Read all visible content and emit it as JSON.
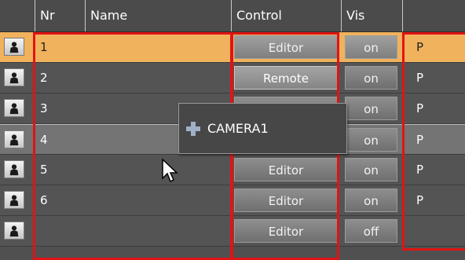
{
  "header": {
    "col_nr": "Nr",
    "col_name": "Name",
    "col_control": "Control",
    "col_vis": "Vis"
  },
  "rows": [
    {
      "nr": "1",
      "control": "Editor",
      "vis": "on",
      "level": "P",
      "state": "selected"
    },
    {
      "nr": "2",
      "control": "Remote",
      "vis": "on",
      "level": "P",
      "state": "normal"
    },
    {
      "nr": "3",
      "control": "",
      "vis": "on",
      "level": "P",
      "state": "normal"
    },
    {
      "nr": "4",
      "control": "Editor",
      "vis": "on",
      "level": "P",
      "state": "hover"
    },
    {
      "nr": "5",
      "control": "Editor",
      "vis": "on",
      "level": "P",
      "state": "normal"
    },
    {
      "nr": "6",
      "control": "Editor",
      "vis": "on",
      "level": "P",
      "state": "normal"
    },
    {
      "nr": "",
      "control": "Editor",
      "vis": "off",
      "level": "",
      "state": "normal"
    }
  ],
  "drag_popup": {
    "label": "CAMERA1",
    "icon": "plus-icon"
  },
  "icons": {
    "row_icon": "camera-person-icon",
    "pointer": "mouse-pointer-icon"
  },
  "colors": {
    "selected_row": "#f0b25c",
    "highlight_border": "#e01414",
    "background": "#505050"
  }
}
